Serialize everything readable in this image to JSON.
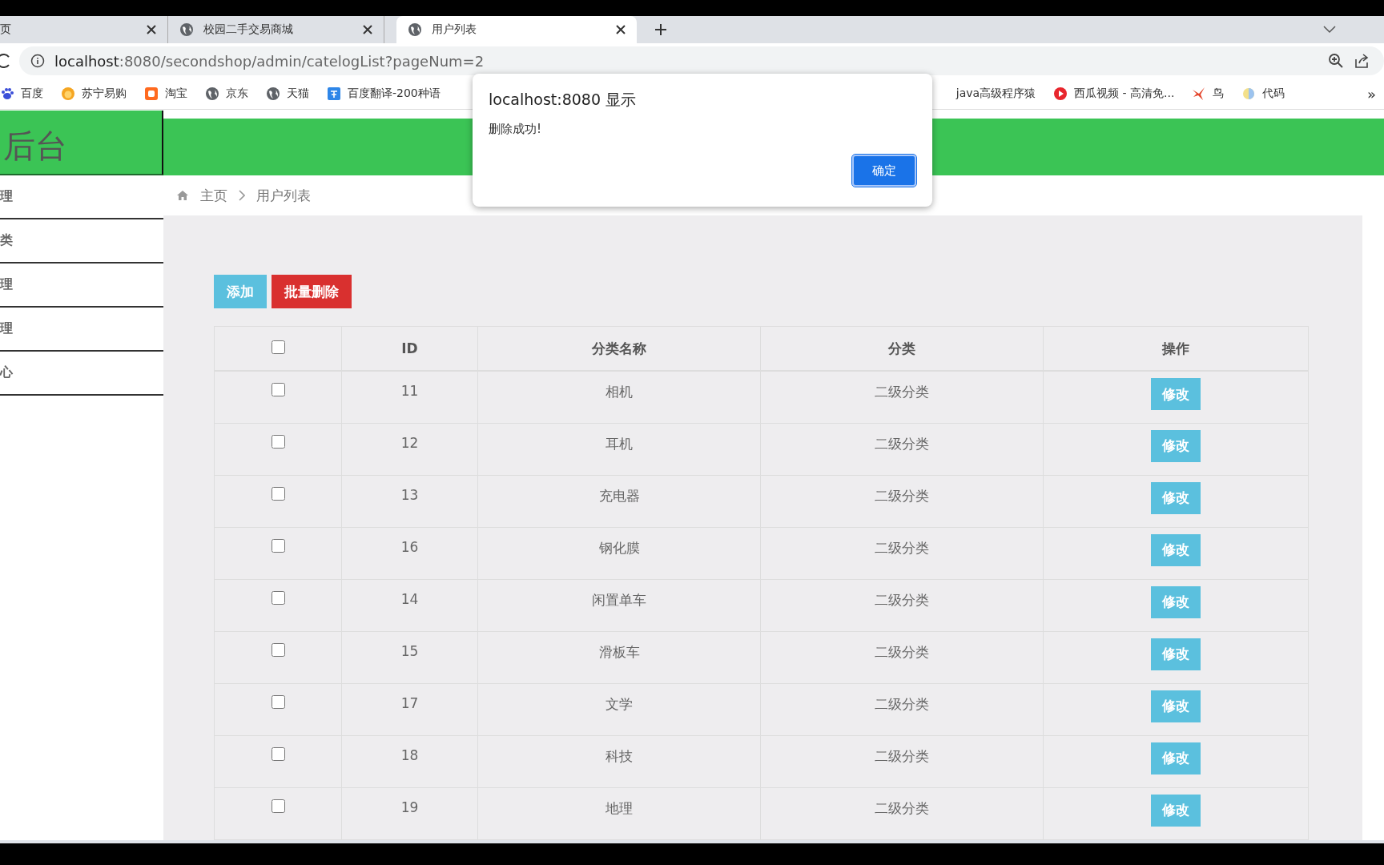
{
  "tabs": [
    {
      "title": "页",
      "selected": false
    },
    {
      "title": "校园二手交易商城",
      "selected": false
    },
    {
      "title": "用户列表",
      "selected": true
    }
  ],
  "address_bar": {
    "host": "localhost",
    "path": ":8080/secondshop/admin/catelogList?pageNum=2"
  },
  "bookmarks": [
    {
      "label": "百度"
    },
    {
      "label": "苏宁易购"
    },
    {
      "label": "淘宝"
    },
    {
      "label": "京东"
    },
    {
      "label": "天猫"
    },
    {
      "label": "百度翻译-200种语"
    },
    {
      "label": "java高级程序猿"
    },
    {
      "label": "西瓜视频 - 高清免..."
    },
    {
      "label": "鸟"
    },
    {
      "label": "代码"
    }
  ],
  "bookmarks_more": "»",
  "header": {
    "logo": "后台"
  },
  "sidebar": {
    "items": [
      "理",
      "类",
      "理",
      "理",
      "心"
    ]
  },
  "breadcrumb": {
    "home": "主页",
    "current": "用户列表"
  },
  "toolbar": {
    "buttons": [
      {
        "label": "添加",
        "kind": "primary"
      },
      {
        "label": "批量删除",
        "kind": "danger"
      }
    ]
  },
  "table": {
    "select_all": {
      "checked": false
    },
    "columns": [
      "ID",
      "分类名称",
      "分类",
      "操作"
    ],
    "rows": [
      {
        "checked": false,
        "id": "11",
        "name": "相机",
        "category": "二级分类",
        "action": "修改"
      },
      {
        "checked": false,
        "id": "12",
        "name": "耳机",
        "category": "二级分类",
        "action": "修改"
      },
      {
        "checked": false,
        "id": "13",
        "name": "充电器",
        "category": "二级分类",
        "action": "修改"
      },
      {
        "checked": false,
        "id": "16",
        "name": "钢化膜",
        "category": "二级分类",
        "action": "修改"
      },
      {
        "checked": false,
        "id": "14",
        "name": "闲置单车",
        "category": "二级分类",
        "action": "修改"
      },
      {
        "checked": false,
        "id": "15",
        "name": "滑板车",
        "category": "二级分类",
        "action": "修改"
      },
      {
        "checked": false,
        "id": "17",
        "name": "文学",
        "category": "二级分类",
        "action": "修改"
      },
      {
        "checked": false,
        "id": "18",
        "name": "科技",
        "category": "二级分类",
        "action": "修改"
      },
      {
        "checked": false,
        "id": "19",
        "name": "地理",
        "category": "二级分类",
        "action": "修改"
      }
    ]
  },
  "dialog": {
    "title": "localhost:8080 显示",
    "message": "删除成功!",
    "button": "确定"
  }
}
